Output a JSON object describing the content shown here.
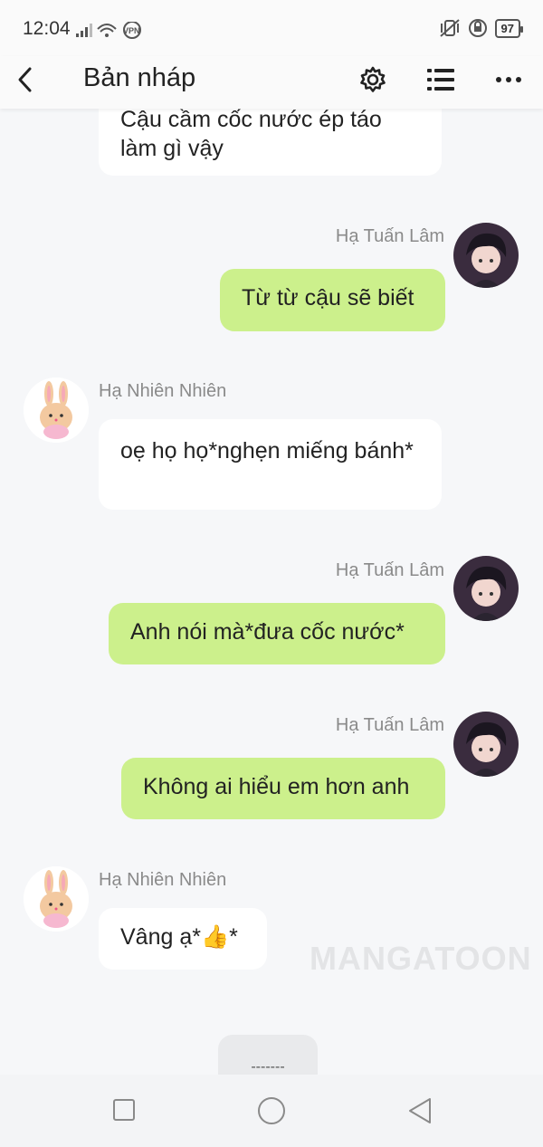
{
  "status_bar": {
    "time": "12:04",
    "vpn": "VPN",
    "battery": "97"
  },
  "header": {
    "title": "Bản nháp"
  },
  "messages": [
    {
      "sender": "",
      "text": "Cậu cầm cốc nước ép táo làm gì vậy"
    },
    {
      "sender": "Hạ Tuấn Lâm",
      "text": "Từ từ cậu sẽ biết"
    },
    {
      "sender": "Hạ Nhiên Nhiên",
      "text": "oẹ họ họ*nghẹn miếng bánh*"
    },
    {
      "sender": "Hạ Tuấn Lâm",
      "text": "Anh nói mà*đưa cốc nước*"
    },
    {
      "sender": "Hạ Tuấn Lâm",
      "text": "Không ai hiểu em hơn anh"
    },
    {
      "sender": "Hạ Nhiên Nhiên",
      "text": "Vâng ạ*👍*"
    }
  ],
  "watermark": "MANGATOON",
  "bottom_tab": "-------",
  "icons": [
    "back-arrow-icon",
    "settings-gear-icon",
    "list-icon",
    "more-dots-icon",
    "square-nav-icon",
    "circle-nav-icon",
    "triangle-back-nav-icon"
  ]
}
